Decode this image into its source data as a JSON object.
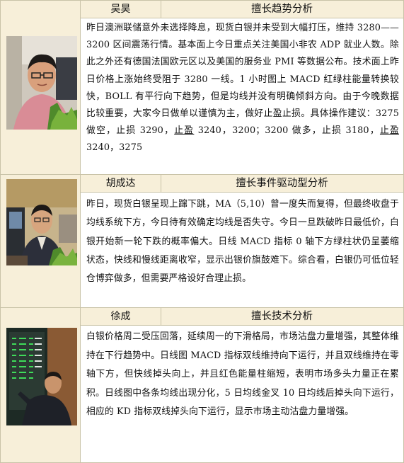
{
  "rows": [
    {
      "name": "吴昊",
      "title": "擅长趋势分析",
      "body_parts": [
        "昨日澳洲联储意外未选择降息，现货白银并未受到大幅打压，维持 3280——3200 区间震荡行情。基本面上今日重点关注美国小非农 ADP 就业人数。除此之外还有德国法国欧元区以及美国的服务业 PMI 等数据公布。技术面上昨日价格上涨始终受阻于 3280 一线。1 小时图上 MACD 红绿柱能量转换较快，BOLL 有平行向下趋势，但是均线并没有明确倾斜方向。由于今晚数据比较重要，大家今日做单以谨慎为主，做好止盈止损。具体操作建议：3275 做空，止损 3290，",
        "止盈",
        " 3240，3200；3200 做多，止损 3180，",
        "止盈",
        " 3240，3275"
      ]
    },
    {
      "name": "胡成达",
      "title": "擅长事件驱动型分析",
      "body": "昨日，现货白银呈现上蹿下跳，MA（5,10）曾一度失而复得，但最终收盘于均线系统下方，今日待有效确定均线是否失守。今日一旦跌破昨日最低价，白银开始新一轮下跌的概率偏大。日线 MACD 指标 0 轴下方绿柱状仍呈萎缩状态，快线和慢线距离收窄，显示出银价旗鼓难下。综合看，白银仍可低位轻仓博弈做多，但需要严格设好合理止损。"
    },
    {
      "name": "徐成",
      "title": "擅长技术分析",
      "body": "白银价格周二受压回落，延续周一的下滑格局，市场沽盘力量增强，其整体维持在下行趋势中。日线图 MACD 指标双线维持向下运行，并且双线维持在零轴下方，但快线掉头向上，并且红色能量柱缩短，表明市场多头力量正在累积。日线图中各条均线出现分化，5 日均线金叉 10 日均线后掉头向下运行，相应的 KD 指标双线掉头向下运行，显示市场主动沽盘力量增强。"
    }
  ]
}
